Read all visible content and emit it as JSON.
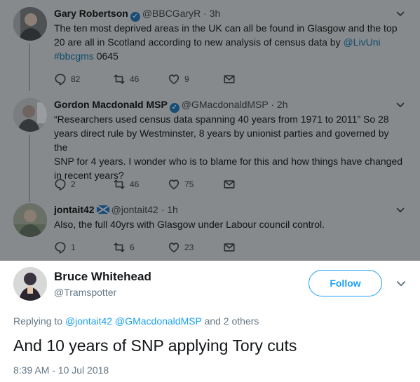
{
  "thread": [
    {
      "name": "Gary Robertson",
      "handle": "@BBCGaryR",
      "dot": "·",
      "time": "3h",
      "text_1": "The ten most deprived areas in the UK can all be found in Glasgow and the top",
      "text_2": "20 are all in Scotland according to new analysis of census data by",
      "mention": "@LivUni",
      "hashtag": "#bbcgms",
      "text_3": "0645",
      "replies": "82",
      "retweets": "46",
      "likes": "9",
      "badge": "verified-icon"
    },
    {
      "name": "Gordon Macdonald MSP",
      "handle": "@GMacdonaldMSP",
      "dot": "·",
      "time": "2h",
      "lines": [
        "“Researchers used census data spanning 40 years from 1971 to 2011” So 28",
        "years direct rule by Westminster, 8 years by unionist parties and governed by the",
        "SNP for 4 years. I wonder who is to blame for this and how things have changed",
        "in recent years?"
      ],
      "replies": "2",
      "retweets": "46",
      "likes": "75",
      "badge": "verified-icon"
    },
    {
      "name": "jontait42",
      "handle": "@jontait42",
      "dot": "·",
      "time": "1h",
      "lines": [
        "Also, the full 40yrs with Glasgow under Labour council control."
      ],
      "replies": "1",
      "retweets": "6",
      "likes": "23",
      "badge": "saltire-flag-icon"
    }
  ],
  "main_tweet": {
    "name": "Bruce Whitehead",
    "handle": "@Tramspotter",
    "follow_label": "Follow",
    "replying_prefix": "Replying to",
    "replying_mention_1": "@jontait42",
    "replying_mention_2": "@GMacdonaldMSP",
    "replying_suffix": "and 2 others",
    "text": "And 10 years of SNP applying Tory cuts",
    "timestamp": "8:39 AM - 10 Jul 2018"
  },
  "colors": {
    "overlay": "#878a8c",
    "accent": "#1da1f2",
    "secondary_text": "#657786"
  }
}
